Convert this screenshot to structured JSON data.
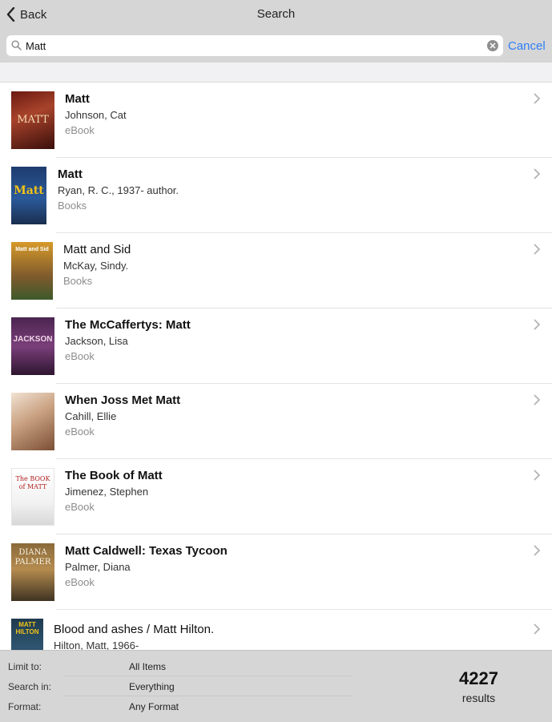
{
  "nav": {
    "back_label": "Back",
    "title": "Search"
  },
  "search": {
    "value": "Matt",
    "cancel_label": "Cancel"
  },
  "results": [
    {
      "title": "Matt",
      "author": "Johnson, Cat",
      "format": "eBook",
      "cover_text": "MATT"
    },
    {
      "title": "Matt",
      "author": "Ryan, R. C., 1937- author.",
      "format": "Books",
      "cover_text": "Matt"
    },
    {
      "title": "Matt and Sid",
      "author": "McKay, Sindy.",
      "format": "Books",
      "cover_text": "Matt and Sid"
    },
    {
      "title": "The McCaffertys: Matt",
      "author": "Jackson, Lisa",
      "format": "eBook",
      "cover_text": "JACKSON"
    },
    {
      "title": "When Joss Met Matt",
      "author": "Cahill, Ellie",
      "format": "eBook",
      "cover_text": ""
    },
    {
      "title": "The Book of Matt",
      "author": "Jimenez, Stephen",
      "format": "eBook",
      "cover_text": "The BOOK of MATT"
    },
    {
      "title": "Matt Caldwell: Texas Tycoon",
      "author": "Palmer, Diana",
      "format": "eBook",
      "cover_text": "DIANA PALMER"
    },
    {
      "title": "Blood and ashes / Matt Hilton.",
      "author": "Hilton, Matt, 1966-",
      "format": "",
      "cover_text": "MATT HILTON"
    }
  ],
  "filters": {
    "limit_label": "Limit to:",
    "limit_value": "All Items",
    "search_in_label": "Search in:",
    "search_in_value": "Everything",
    "format_label": "Format:",
    "format_value": "Any Format"
  },
  "summary": {
    "count": "4227",
    "label": "results"
  },
  "colors": {
    "accent": "#2f7ff6",
    "bar": "#d6d6d6"
  }
}
